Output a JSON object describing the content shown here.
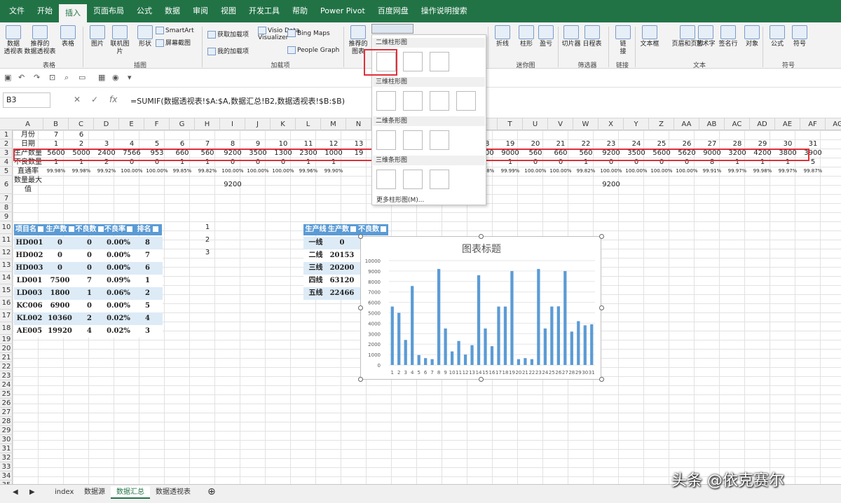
{
  "menu": {
    "tabs": [
      "文件",
      "开始",
      "插入",
      "页面布局",
      "公式",
      "数据",
      "审阅",
      "视图",
      "开发工具",
      "帮助",
      "Power Pivot",
      "百度网盘",
      "操作说明搜索"
    ],
    "active": "插入"
  },
  "ribbon": {
    "buttons": [
      {
        "label": "数据\n透视表"
      },
      {
        "label": "推荐的\n数据透视表"
      },
      {
        "label": "表格"
      },
      {
        "label": "图片"
      },
      {
        "label": "联机图片"
      },
      {
        "label": "形状"
      },
      {
        "label": "推荐的\n图表"
      },
      {
        "label": "折线"
      },
      {
        "label": "柱形"
      },
      {
        "label": "盈亏"
      },
      {
        "label": "切片器"
      },
      {
        "label": "日程表"
      },
      {
        "label": "链\n接"
      },
      {
        "label": "文本框"
      },
      {
        "label": "页眉和页脚"
      },
      {
        "label": "艺术字"
      },
      {
        "label": "签名行"
      },
      {
        "label": "对象"
      },
      {
        "label": "公式"
      },
      {
        "label": "符号"
      }
    ],
    "small": [
      "SmartArt",
      "屏幕截图",
      "获取加载项",
      "我的加载项",
      "Visio Data\nVisualizer",
      "Bing Maps",
      "People Graph"
    ],
    "groups": [
      "表格",
      "插图",
      "加载项",
      "迷你图",
      "筛选器",
      "链接",
      "文本",
      "符号"
    ]
  },
  "formula_bar": {
    "name_box": "B3",
    "formula": "=SUMIF(数据透视表!$A:$A,数据汇总!B2,数据透视表!$B:$B)"
  },
  "columns": [
    "A",
    "B",
    "C",
    "D",
    "E",
    "F",
    "G",
    "H",
    "I",
    "J",
    "K",
    "L",
    "M",
    "N",
    "O",
    "P",
    "Q",
    "R",
    "S",
    "T",
    "U",
    "V",
    "W",
    "X",
    "Y",
    "Z",
    "AA",
    "AB",
    "AC",
    "AD",
    "AE",
    "AF",
    "AG"
  ],
  "sheet": {
    "r1": {
      "label": "月份",
      "b": "7",
      "c": "6"
    },
    "r2": {
      "label": "日期",
      "days": [
        "1",
        "2",
        "3",
        "4",
        "5",
        "6",
        "7",
        "8",
        "9",
        "10",
        "11",
        "12",
        "13",
        "18",
        "19",
        "20",
        "21",
        "22",
        "23",
        "24",
        "25",
        "26",
        "27",
        "28",
        "29",
        "30",
        "31"
      ]
    },
    "r3": {
      "label": "生产数量",
      "values": [
        "5600",
        "5000",
        "2400",
        "7566",
        "953",
        "660",
        "560",
        "9200",
        "3500",
        "1300",
        "2300",
        "1000",
        "19",
        "5600",
        "9000",
        "560",
        "660",
        "560",
        "9200",
        "3500",
        "5600",
        "5620",
        "9000",
        "3200",
        "4200",
        "3800",
        "3900"
      ]
    },
    "r4": {
      "label": "不良数量",
      "values": [
        "1",
        "1",
        "2",
        "0",
        "0",
        "1",
        "1",
        "0",
        "0",
        "0",
        "1",
        "1",
        "",
        "1",
        "1",
        "0",
        "0",
        "1",
        "0",
        "0",
        "0",
        "0",
        "8",
        "1",
        "1",
        "1",
        "5"
      ]
    },
    "r5": {
      "label": "直通率",
      "values": [
        "99.98%",
        "99.98%",
        "99.92%",
        "100.00%",
        "100.00%",
        "99.85%",
        "99.82%",
        "100.00%",
        "100.00%",
        "100.00%",
        "99.96%",
        "99.90%",
        "",
        "99.98%",
        "99.99%",
        "100.00%",
        "100.00%",
        "99.82%",
        "100.00%",
        "100.00%",
        "100.00%",
        "100.00%",
        "99.91%",
        "99.97%",
        "99.98%",
        "99.97%",
        "99.87%"
      ]
    },
    "r6": {
      "label": "数量最大值",
      "i": "9200",
      "x": "9200"
    },
    "h_col": [
      "1",
      "2",
      "3"
    ]
  },
  "pivot1": {
    "headers": [
      "项目名",
      "生产数",
      "不良数",
      "不良率",
      "排名"
    ],
    "rows": [
      [
        "HD001",
        "0",
        "0",
        "0.00%",
        "8"
      ],
      [
        "HD002",
        "0",
        "0",
        "0.00%",
        "7"
      ],
      [
        "HD003",
        "0",
        "0",
        "0.00%",
        "6"
      ],
      [
        "LD001",
        "7500",
        "7",
        "0.09%",
        "1"
      ],
      [
        "LD003",
        "1800",
        "1",
        "0.06%",
        "2"
      ],
      [
        "KC006",
        "6900",
        "0",
        "0.00%",
        "5"
      ],
      [
        "KL002",
        "10360",
        "2",
        "0.02%",
        "4"
      ],
      [
        "AE005",
        "19920",
        "4",
        "0.02%",
        "3"
      ]
    ]
  },
  "pivot2": {
    "headers": [
      "生产线",
      "生产数",
      "不良数"
    ],
    "rows": [
      [
        "一线",
        "0"
      ],
      [
        "二线",
        "20153"
      ],
      [
        "三线",
        "20200"
      ],
      [
        "四线",
        "63120"
      ],
      [
        "五线",
        "22466"
      ]
    ]
  },
  "gallery": {
    "sections": [
      "二维柱形图",
      "三维柱形图",
      "二维条形图",
      "三维条形图"
    ],
    "more": "更多柱形图(M)..."
  },
  "chart_data": {
    "type": "bar",
    "title": "图表标题",
    "categories": [
      "1",
      "2",
      "3",
      "4",
      "5",
      "6",
      "7",
      "8",
      "9",
      "10",
      "11",
      "12",
      "13",
      "14",
      "15",
      "16",
      "17",
      "18",
      "19",
      "20",
      "21",
      "22",
      "23",
      "24",
      "25",
      "26",
      "27",
      "28",
      "29",
      "30",
      "31"
    ],
    "values": [
      5600,
      5000,
      2400,
      7566,
      953,
      660,
      560,
      9200,
      3500,
      1300,
      2300,
      1000,
      1900,
      8600,
      3500,
      1800,
      5600,
      5600,
      9000,
      560,
      660,
      560,
      9200,
      3500,
      5600,
      5620,
      9000,
      3200,
      4200,
      3800,
      3900
    ],
    "ylim": [
      0,
      10000
    ],
    "yticks": [
      0,
      1000,
      2000,
      3000,
      4000,
      5000,
      6000,
      7000,
      8000,
      9000,
      10000
    ],
    "color": "#5b9bd5"
  },
  "sheet_tabs": [
    "index",
    "数据源",
    "数据汇总",
    "数据透视表"
  ],
  "active_sheet": "数据汇总",
  "watermark": "头条 @依克赛尔"
}
